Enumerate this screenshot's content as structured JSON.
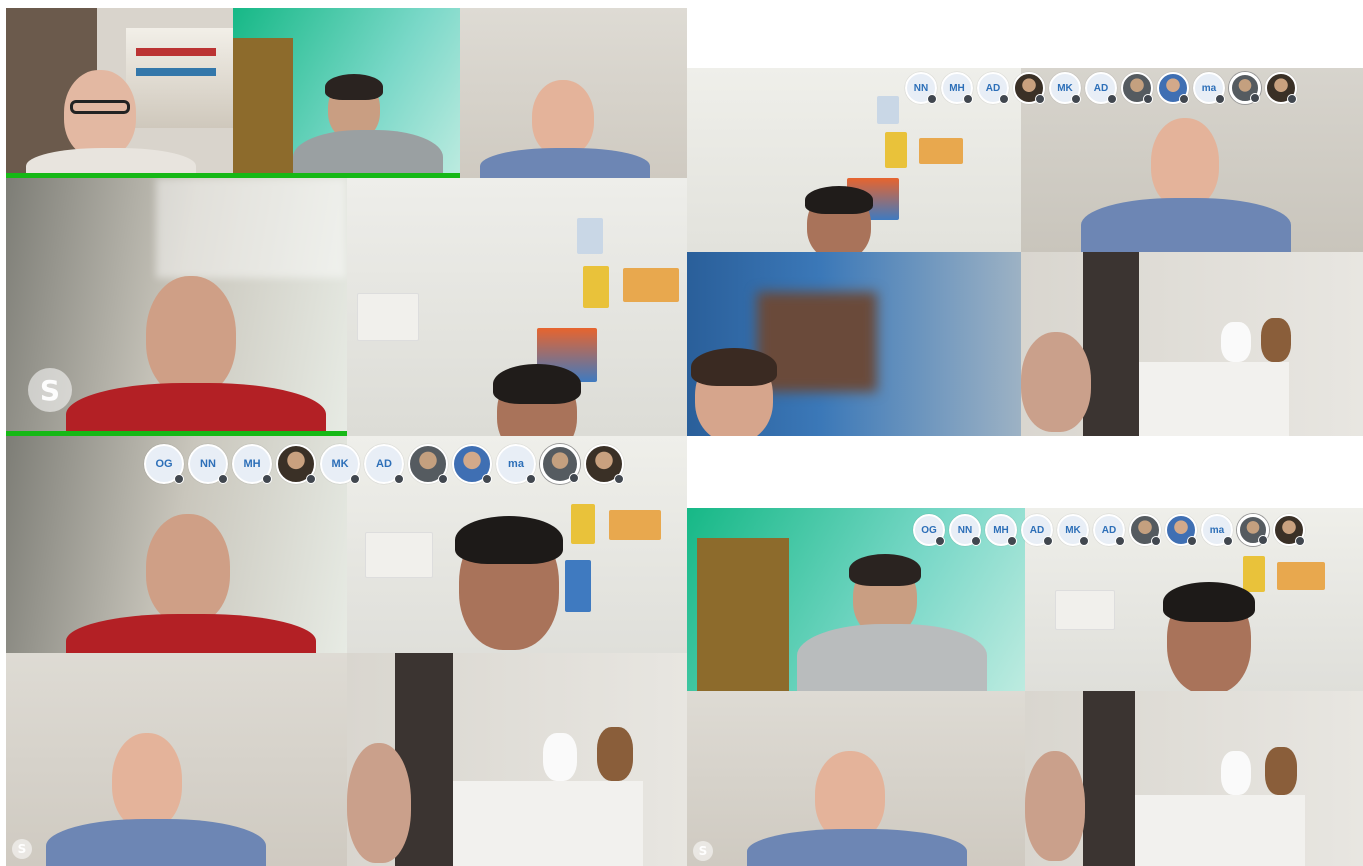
{
  "panels": [
    {
      "id": "call-1",
      "tiles": 5,
      "roster": []
    },
    {
      "id": "call-2",
      "roster": [
        "NN",
        "MH",
        "AD",
        "photo",
        "MK",
        "AD",
        "photo",
        "photo",
        "ma",
        "photo",
        "photo"
      ]
    },
    {
      "id": "call-3",
      "roster": [
        "OG",
        "NN",
        "MH",
        "photo",
        "MK",
        "AD",
        "photo",
        "photo",
        "ma",
        "photo",
        "photo"
      ]
    },
    {
      "id": "call-4",
      "roster": [
        "OG",
        "NN",
        "MH",
        "AD",
        "MK",
        "AD",
        "photo",
        "photo",
        "ma",
        "photo",
        "photo"
      ]
    }
  ],
  "icons": {
    "app": "skype-icon",
    "mic": "microphone-icon"
  },
  "colors": {
    "speaking_indicator": "#16b816",
    "initials_text": "#2d6fb8",
    "initials_bg": "#e8eef6"
  }
}
